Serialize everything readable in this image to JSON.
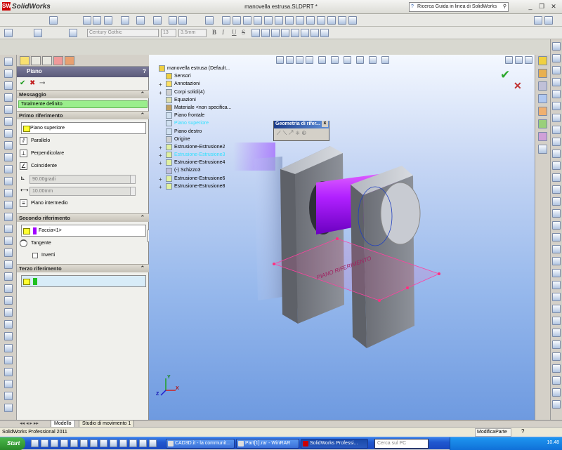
{
  "app": {
    "name": "SolidWorks",
    "logo_letters": "SW"
  },
  "title_bar": {
    "doc_title": "manovella estrusa.SLDPRT *",
    "help_search_placeholder": "Ricerca Guida in linea di SolidWorks",
    "min": "_",
    "restore": "❐",
    "close": "✕"
  },
  "format_toolbar": {
    "font": "Century Gothic",
    "size": "13",
    "height": "3.5mm",
    "bold": "B",
    "italic": "I",
    "underline": "U",
    "strike": "S"
  },
  "property_manager": {
    "title": "Piano",
    "help": "?",
    "ok": "✔",
    "cancel": "✖",
    "pin": "⊸",
    "message_section": "Messaggio",
    "message": "Totalmente definito",
    "first_ref": {
      "header": "Primo riferimento",
      "selection": "Piano superiore",
      "options": [
        "Parallelo",
        "Perpendicolare",
        "Coincidente"
      ],
      "angle": "90.00gradi",
      "distance": "10.00mm",
      "midplane": "Piano intermedio"
    },
    "second_ref": {
      "header": "Secondo riferimento",
      "selection": "Faccia<1>",
      "tangent": "Tangente",
      "invert": "Inverti"
    },
    "third_ref": {
      "header": "Terzo riferimento"
    }
  },
  "feature_tree": {
    "root": "manovella estrusa  (Default...",
    "items": [
      {
        "label": "Sensori",
        "expand": ""
      },
      {
        "label": "Annotazioni",
        "expand": "+"
      },
      {
        "label": "Corpi solidi(4)",
        "expand": "+"
      },
      {
        "label": "Equazioni",
        "expand": ""
      },
      {
        "label": "Materiale <non specifica...",
        "expand": ""
      },
      {
        "label": "Piano frontale",
        "expand": ""
      },
      {
        "label": "Piano superiore",
        "expand": "",
        "highlight": true
      },
      {
        "label": "Piano destro",
        "expand": ""
      },
      {
        "label": "Origine",
        "expand": ""
      },
      {
        "label": "Estrusione-Estrusione2",
        "expand": "+"
      },
      {
        "label": "Estrusione-Estrusione3",
        "expand": "+",
        "highlight": true
      },
      {
        "label": "Estrusione-Estrusione4",
        "expand": "+"
      },
      {
        "label": "(-) Schizzo3",
        "expand": ""
      },
      {
        "label": "Estrusione-Estrusione6",
        "expand": "+"
      },
      {
        "label": "Estrusione-Estrusione8",
        "expand": "+"
      }
    ]
  },
  "ref_geometry_toolbar": {
    "title": "Geometria di rifer...",
    "close": "x"
  },
  "model_text": "PIANO RIFERIMENTO",
  "triad": {
    "x": "X",
    "y": "Y",
    "z": "Z"
  },
  "bottom_tabs": [
    "Modello",
    "Studio di movimento 1"
  ],
  "status": {
    "left": "SolidWorks Professional 2011",
    "mode": "ModificaParte"
  },
  "taskbar": {
    "start": "Start",
    "tasks": [
      "CAD3D.it - la communit...",
      "Part[1].rar - WinRAR",
      "SolidWorks Professi..."
    ],
    "search_placeholder": "Cerca sul PC",
    "clock": "10.48"
  },
  "colors": {
    "accent": "#ffff30",
    "selection2": "#a000ff",
    "highlight": "#30e0ff",
    "cylinder": "#b020ff",
    "message_bg": "#9aee8c"
  }
}
